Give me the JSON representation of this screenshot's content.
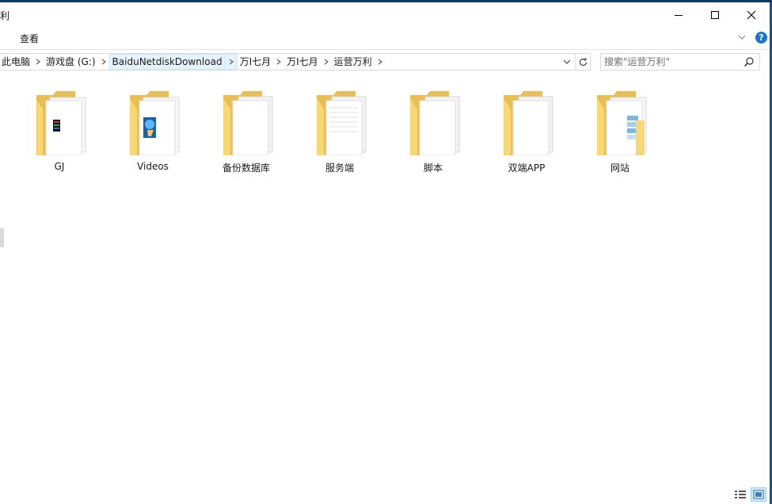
{
  "window": {
    "title_fragment": "利",
    "controls": {
      "minimize": "minimize-icon",
      "maximize": "maximize-icon",
      "close": "close-icon"
    }
  },
  "menu": {
    "view_label": "查看",
    "help": "?"
  },
  "address": {
    "crumbs": [
      {
        "label": "此电脑"
      },
      {
        "label": "游戏盘 (G:)"
      },
      {
        "label": "BaiduNetdiskDownload"
      },
      {
        "label": "万I七月"
      },
      {
        "label": "万I七月"
      },
      {
        "label": "运营万利"
      }
    ],
    "highlighted_crumb": 2
  },
  "search": {
    "placeholder": "搜索\"运营万利\""
  },
  "folders": [
    {
      "name": "GJ",
      "icon": "folder-gj-icon"
    },
    {
      "name": "Videos",
      "icon": "folder-videos-icon"
    },
    {
      "name": "备份数据库",
      "icon": "folder-documents-icon"
    },
    {
      "name": "服务端",
      "icon": "folder-documents-icon"
    },
    {
      "name": "脚本",
      "icon": "folder-documents-icon"
    },
    {
      "name": "双端APP",
      "icon": "folder-documents-icon"
    },
    {
      "name": "网站",
      "icon": "folder-images-icon"
    }
  ],
  "status": {
    "views": [
      "details-view-icon",
      "large-icons-view-icon"
    ],
    "active_view": "large-icons-view-icon"
  },
  "colors": {
    "accent": "#1874cd",
    "folder_back": "#e8bf57",
    "folder_front": "#f8d775",
    "selection": "#cce8ff",
    "frame": "#0b3a66"
  }
}
